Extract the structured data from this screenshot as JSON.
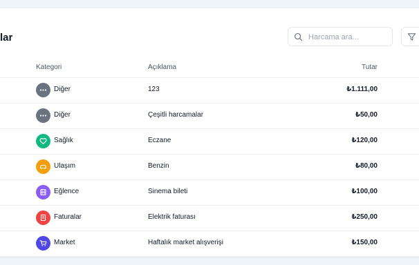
{
  "header": {
    "title": "lar"
  },
  "search": {
    "placeholder": "Harcama ara..."
  },
  "table": {
    "columns": {
      "category": "Kategori",
      "description": "Açıklama",
      "amount": "Tutar"
    },
    "rows": [
      {
        "category": "Diğer",
        "description": "123",
        "amount": "₺1.111,00",
        "icon": "more-icon",
        "color": "#6b7280"
      },
      {
        "category": "Diğer",
        "description": "Çeşitli harcamalar",
        "amount": "₺50,00",
        "icon": "more-icon",
        "color": "#6b7280"
      },
      {
        "category": "Sağlık",
        "description": "Eczane",
        "amount": "₺120,00",
        "icon": "heart-icon",
        "color": "#10b981"
      },
      {
        "category": "Ulaşım",
        "description": "Benzin",
        "amount": "₺80,00",
        "icon": "car-icon",
        "color": "#f59e0b"
      },
      {
        "category": "Eğlence",
        "description": "Sinema bileti",
        "amount": "₺100,00",
        "icon": "film-icon",
        "color": "#8b5cf6"
      },
      {
        "category": "Faturalar",
        "description": "Elektrik faturası",
        "amount": "₺250,00",
        "icon": "receipt-icon",
        "color": "#ef4444"
      },
      {
        "category": "Market",
        "description": "Haftalık market alışverişi",
        "amount": "₺150,00",
        "icon": "cart-icon",
        "color": "#4f46e5"
      }
    ]
  }
}
